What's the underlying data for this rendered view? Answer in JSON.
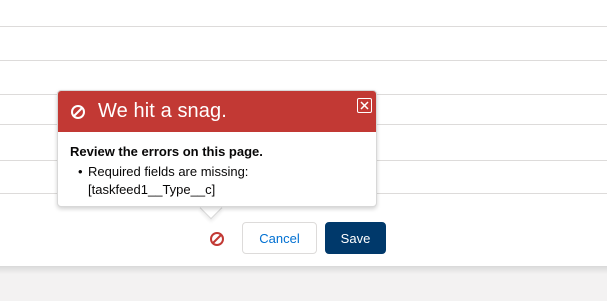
{
  "error_popover": {
    "title": "We hit a snag.",
    "heading": "Review the errors on this page.",
    "errors": [
      {
        "message": "Required fields are missing:",
        "fields": "[taskfeed1__Type__c]"
      }
    ],
    "close_icon": "close-icon",
    "header_icon": "ban-icon"
  },
  "footer": {
    "error_icon": "ban-icon",
    "cancel_label": "Cancel",
    "save_label": "Save"
  },
  "colors": {
    "error_header": "#c23934",
    "save_button": "#00396b",
    "cancel_text": "#0070d2",
    "error_icon": "#c23934"
  }
}
